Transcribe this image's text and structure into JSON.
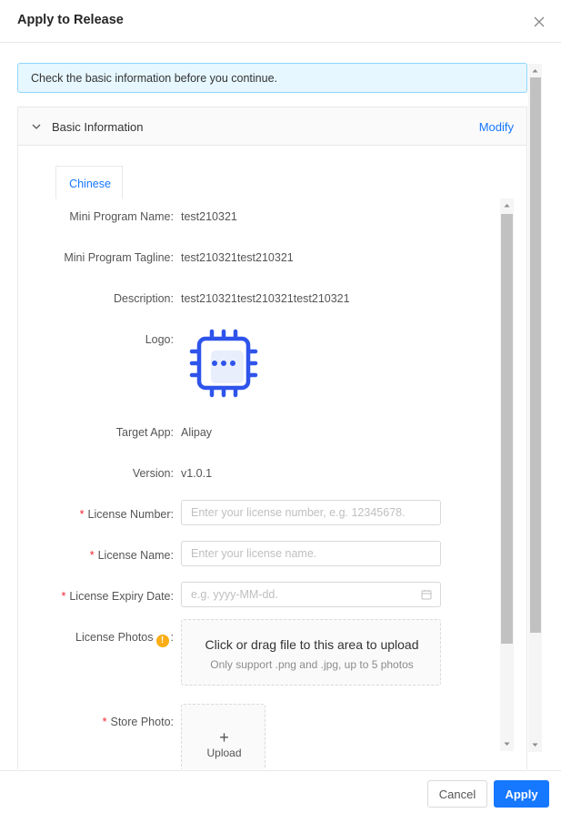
{
  "dialog": {
    "title": "Apply to Release"
  },
  "alert": {
    "text": "Check the basic information before you continue."
  },
  "card": {
    "title": "Basic Information",
    "modify_label": "Modify"
  },
  "language_tab": {
    "label": "Chinese"
  },
  "fields": {
    "mini_program_name": {
      "label": "Mini Program Name",
      "value": "test210321"
    },
    "tagline": {
      "label": "Mini Program Tagline",
      "value": "test210321test210321"
    },
    "description": {
      "label": "Description",
      "value": "test210321test210321test210321"
    },
    "logo": {
      "label": "Logo"
    },
    "target_app": {
      "label": "Target App",
      "value": "Alipay"
    },
    "version": {
      "label": "Version",
      "value": "v1.0.1"
    },
    "license_number": {
      "label": "License Number",
      "placeholder": "Enter your license number, e.g. 12345678."
    },
    "license_name": {
      "label": "License Name",
      "placeholder": "Enter your license name."
    },
    "license_expiry": {
      "label": "License Expiry Date",
      "placeholder": "e.g. yyyy-MM-dd."
    },
    "license_photos": {
      "label": "License Photos",
      "upload_title": "Click or drag file to this area to upload",
      "upload_hint": "Only support .png and .jpg, up to 5 photos"
    },
    "store_photo": {
      "label": "Store Photo",
      "upload_label": "Upload"
    }
  },
  "colon": ":",
  "required_mark": "*",
  "footer": {
    "cancel_label": "Cancel",
    "apply_label": "Apply"
  },
  "colors": {
    "primary": "#1677ff",
    "required": "#f5222d",
    "info": "#faad14",
    "alert_bg": "#e6f7ff",
    "alert_border": "#91d5ff",
    "logo": "#2f54eb"
  }
}
